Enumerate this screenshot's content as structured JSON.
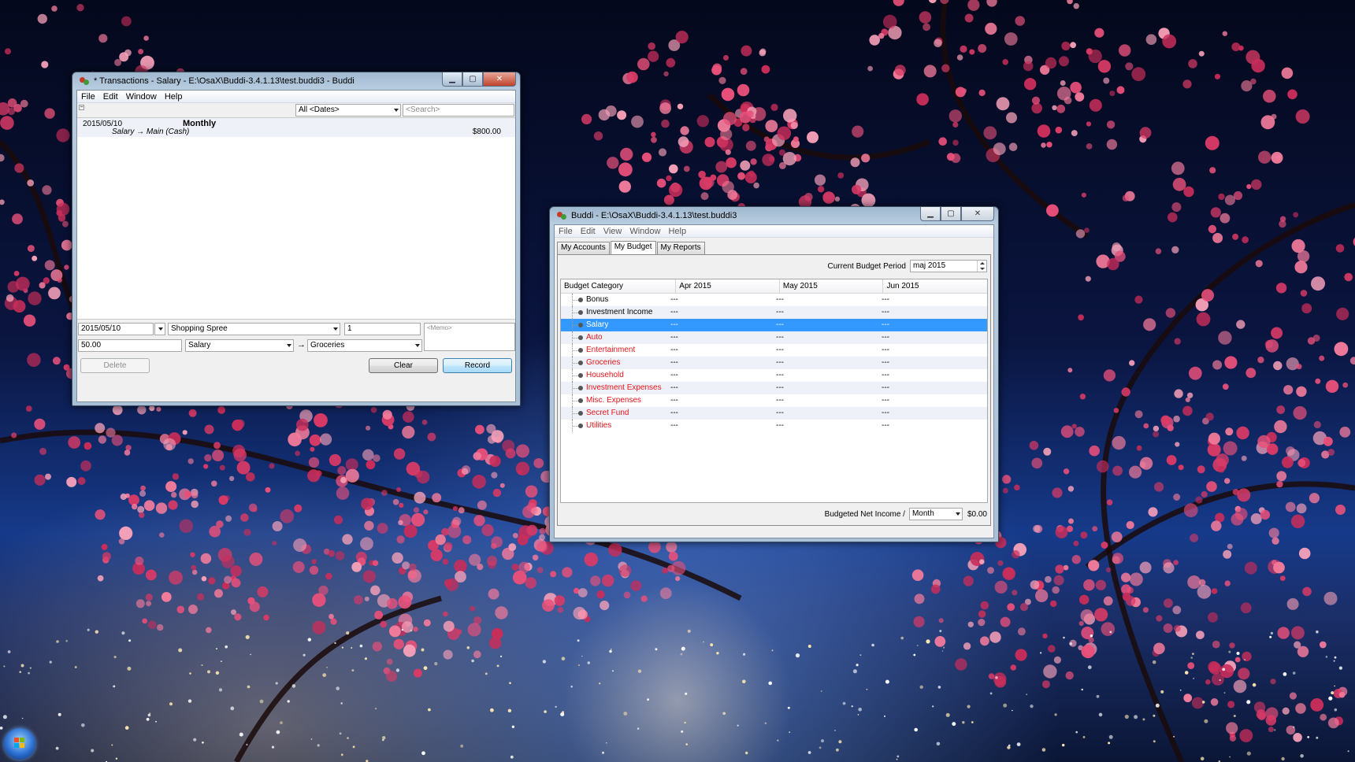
{
  "desktop": {
    "wallpaper": "cherry-blossom-night-city"
  },
  "transactions_window": {
    "title": "* Transactions - Salary - E:\\OsaX\\Buddi-3.4.1.13\\test.buddi3 - Buddi",
    "menu": [
      "File",
      "Edit",
      "Window",
      "Help"
    ],
    "date_filter": "All <Dates>",
    "search_placeholder": "<Search>",
    "transactions": [
      {
        "date": "2015/05/10",
        "description": "Monthly",
        "accounts": "Salary  → Main (Cash)",
        "amount": "$800.00"
      }
    ],
    "editor": {
      "date": "2015/05/10",
      "description": "Shopping Spree",
      "number": "1",
      "memo_placeholder": "<Memo>",
      "amount": "50.00",
      "from_account": "Salary",
      "arrow": "→",
      "to_account": "Groceries"
    },
    "buttons": {
      "delete": "Delete",
      "clear": "Clear",
      "record": "Record"
    }
  },
  "buddi_window": {
    "title": "Buddi - E:\\OsaX\\Buddi-3.4.1.13\\test.buddi3",
    "menu": [
      "File",
      "Edit",
      "View",
      "Window",
      "Help"
    ],
    "tabs": [
      "My Accounts",
      "My Budget",
      "My Reports"
    ],
    "active_tab": "My Budget",
    "period_label": "Current Budget Period",
    "period_value": "maj 2015",
    "columns": [
      "Budget Category",
      "Apr 2015",
      "May 2015",
      "Jun 2015"
    ],
    "rows": [
      {
        "name": "Bonus",
        "apr": "---",
        "may": "---",
        "jun": "---",
        "type": "income"
      },
      {
        "name": "Investment Income",
        "apr": "---",
        "may": "---",
        "jun": "---",
        "type": "income"
      },
      {
        "name": "Salary",
        "apr": "---",
        "may": "---",
        "jun": "---",
        "type": "income",
        "selected": true
      },
      {
        "name": "Auto",
        "apr": "---",
        "may": "---",
        "jun": "---",
        "type": "expense"
      },
      {
        "name": "Entertainment",
        "apr": "---",
        "may": "---",
        "jun": "---",
        "type": "expense"
      },
      {
        "name": "Groceries",
        "apr": "---",
        "may": "---",
        "jun": "---",
        "type": "expense"
      },
      {
        "name": "Household",
        "apr": "---",
        "may": "---",
        "jun": "---",
        "type": "expense"
      },
      {
        "name": "Investment Expenses",
        "apr": "---",
        "may": "---",
        "jun": "---",
        "type": "expense"
      },
      {
        "name": "Misc. Expenses",
        "apr": "---",
        "may": "---",
        "jun": "---",
        "type": "expense"
      },
      {
        "name": "Secret Fund",
        "apr": "---",
        "may": "---",
        "jun": "---",
        "type": "expense"
      },
      {
        "name": "Utilities",
        "apr": "---",
        "may": "---",
        "jun": "---",
        "type": "expense"
      }
    ],
    "footer": {
      "label": "Budgeted Net Income /",
      "period": "Month",
      "value": "$0.00"
    },
    "colors": {
      "expense_text": "#e8141a",
      "selection": "#3399ff"
    }
  }
}
